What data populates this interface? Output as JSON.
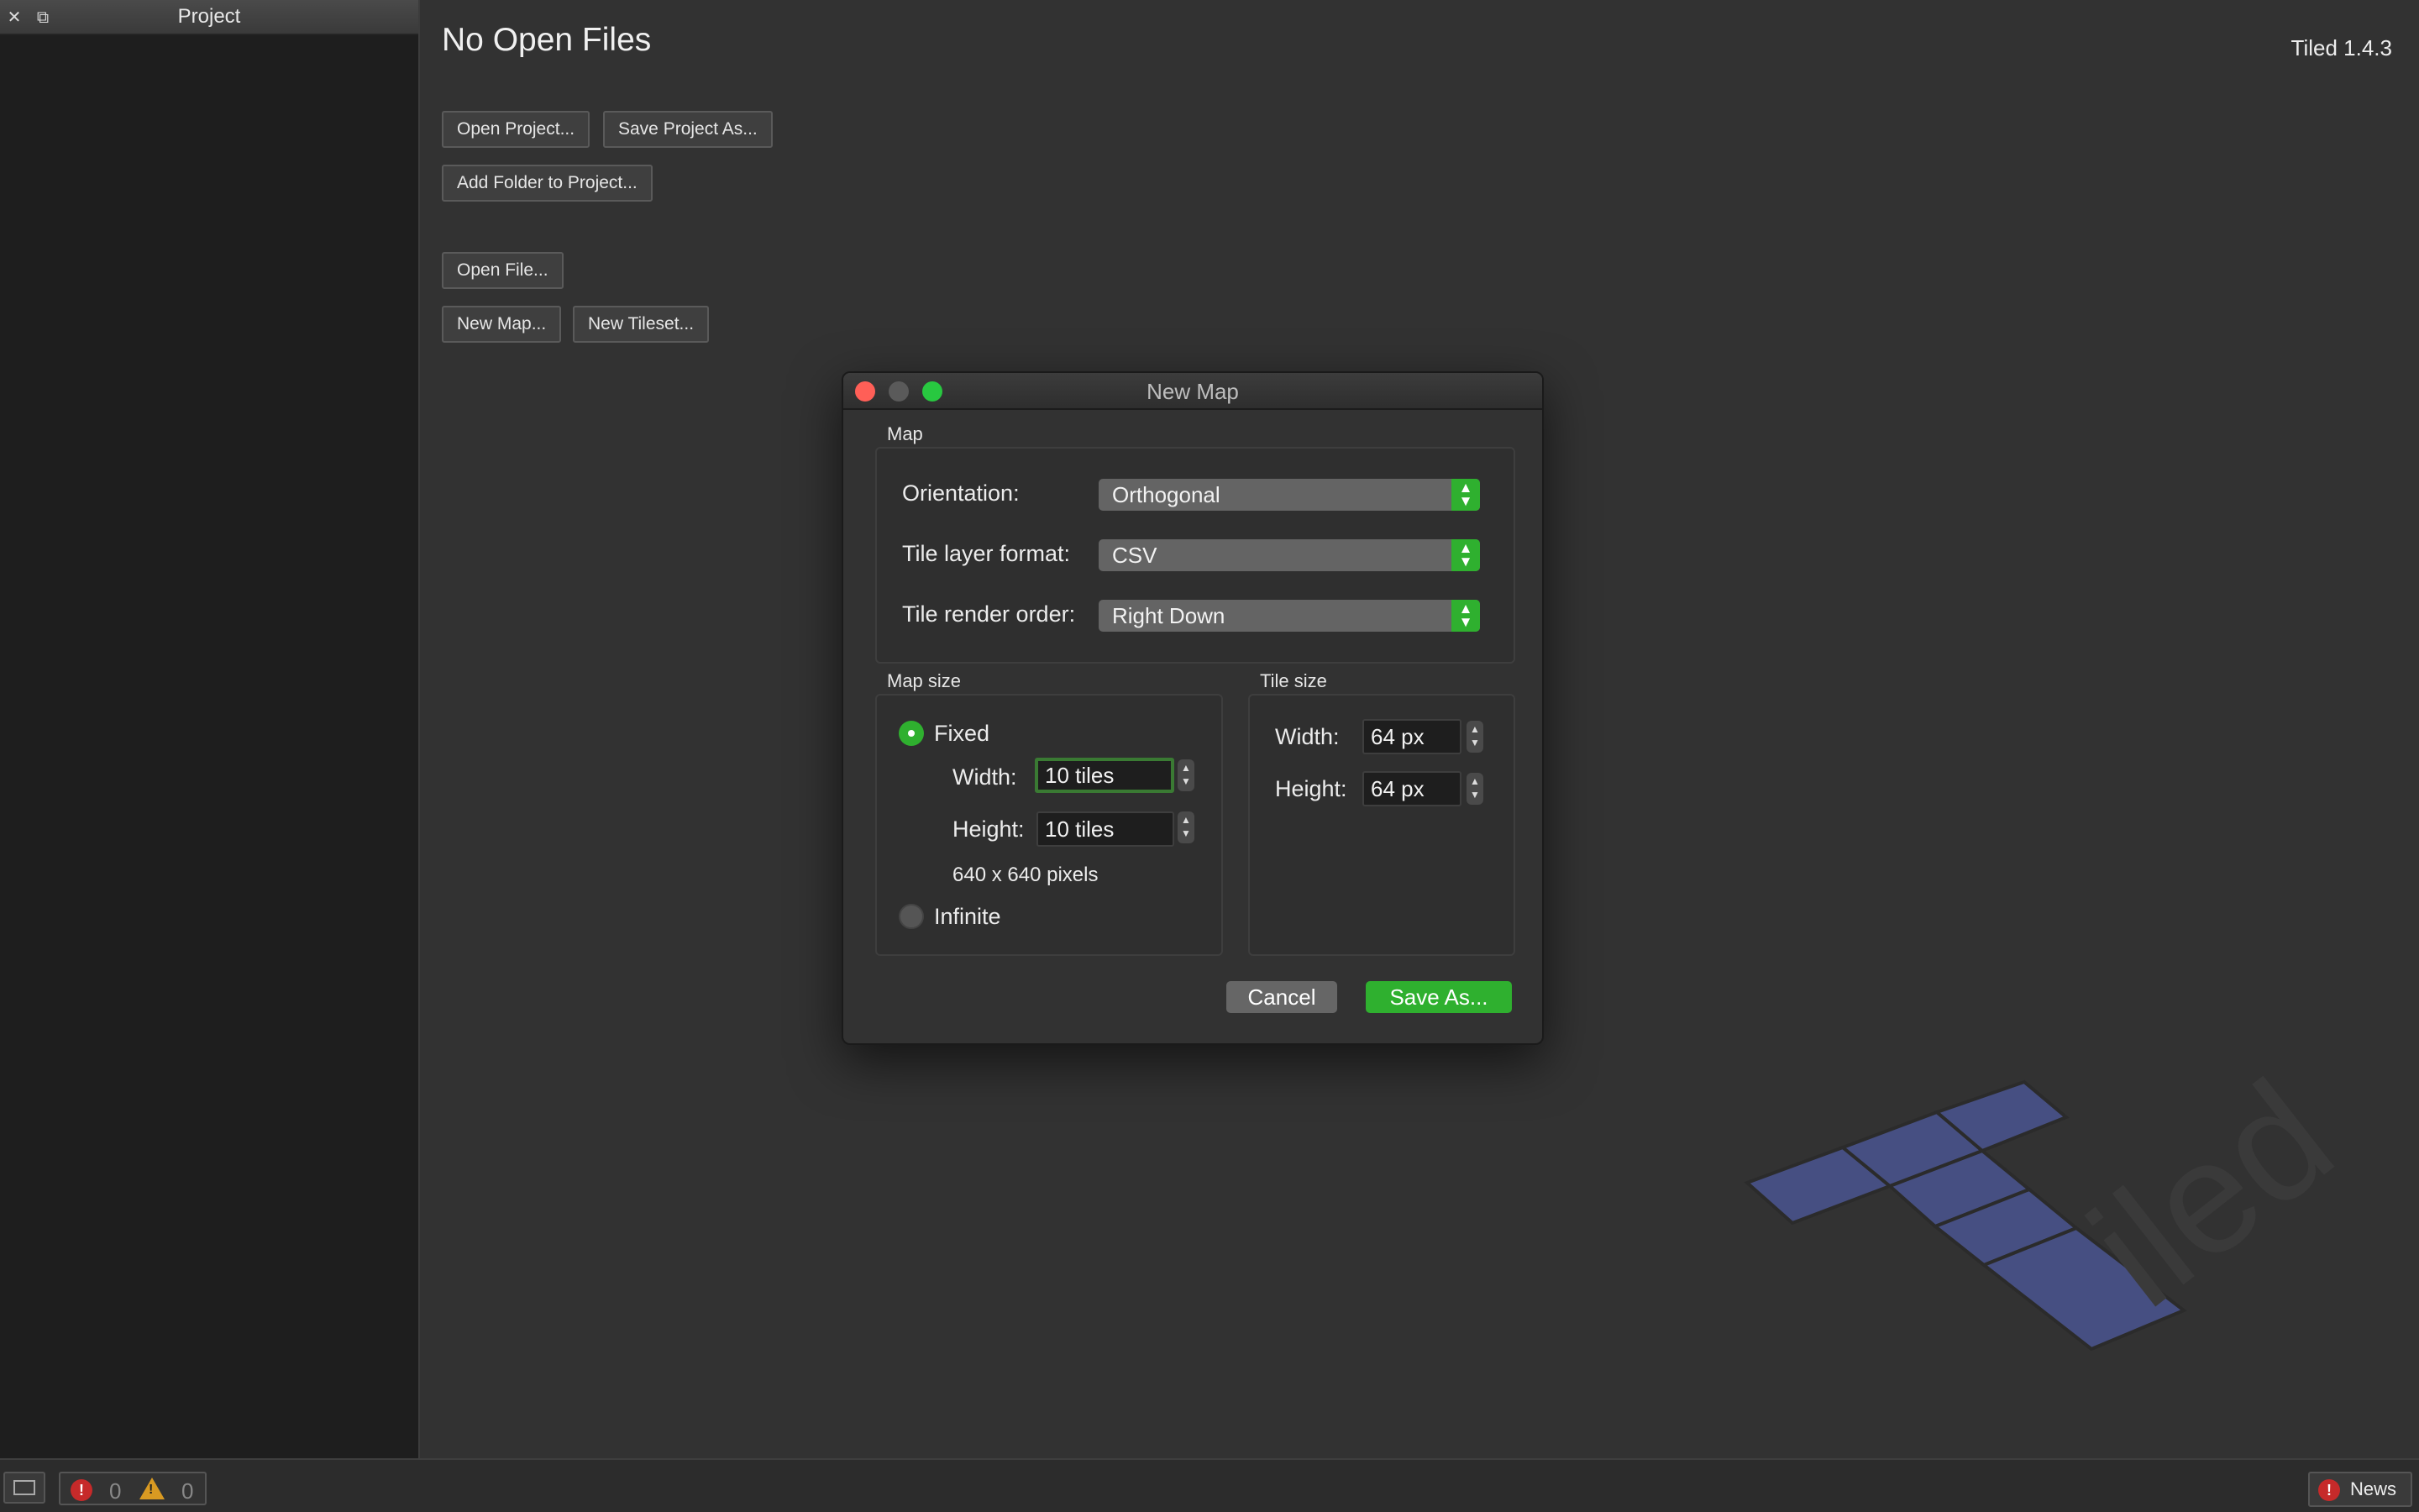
{
  "project_panel": {
    "title": "Project",
    "close_icon": "✕",
    "float_icon": "⧉"
  },
  "main": {
    "title": "No Open Files",
    "version": "Tiled 1.4.3",
    "buttons": {
      "open_project": "Open Project...",
      "save_project_as": "Save Project As...",
      "add_folder": "Add Folder to Project...",
      "open_file": "Open File...",
      "new_map": "New Map...",
      "new_tileset": "New Tileset..."
    },
    "logo_text": "iled"
  },
  "dialog": {
    "title": "New Map",
    "map_group": {
      "title": "Map",
      "orientation_label": "Orientation:",
      "orientation_value": "Orthogonal",
      "format_label": "Tile layer format:",
      "format_value": "CSV",
      "render_label": "Tile render order:",
      "render_value": "Right Down"
    },
    "map_size": {
      "title": "Map size",
      "fixed_label": "Fixed",
      "fixed_selected": true,
      "width_label": "Width:",
      "width_value": "10 tiles",
      "height_label": "Height:",
      "height_value": "10 tiles",
      "pixels_text": "640 x 640 pixels",
      "infinite_label": "Infinite"
    },
    "tile_size": {
      "title": "Tile size",
      "width_label": "Width:",
      "width_value": "64 px",
      "height_label": "Height:",
      "height_value": "64 px"
    },
    "cancel_label": "Cancel",
    "save_label": "Save As..."
  },
  "statusbar": {
    "error_count": "0",
    "warning_count": "0",
    "news_label": "News"
  },
  "colors": {
    "accent": "#2fb02f",
    "background": "#323232",
    "panel": "#1e1e1e"
  }
}
